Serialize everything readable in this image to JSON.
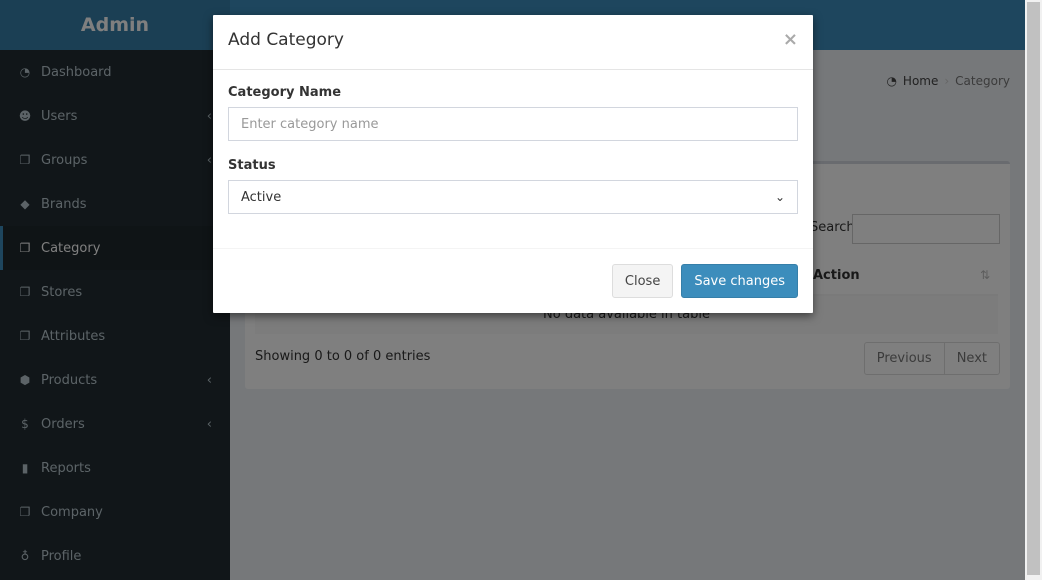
{
  "app": {
    "logo": "Admin"
  },
  "sidebar": {
    "items": [
      {
        "label": "Dashboard",
        "icon": "dashboard-icon",
        "glyph": "◔",
        "chevron": false,
        "active": false
      },
      {
        "label": "Users",
        "icon": "users-icon",
        "glyph": "☻",
        "chevron": true,
        "active": false
      },
      {
        "label": "Groups",
        "icon": "files-icon",
        "glyph": "❐",
        "chevron": true,
        "active": false
      },
      {
        "label": "Brands",
        "icon": "tags-icon",
        "glyph": "◆",
        "chevron": false,
        "active": false
      },
      {
        "label": "Category",
        "icon": "files-icon",
        "glyph": "❐",
        "chevron": false,
        "active": true
      },
      {
        "label": "Stores",
        "icon": "files-icon",
        "glyph": "❐",
        "chevron": false,
        "active": false
      },
      {
        "label": "Attributes",
        "icon": "files-icon",
        "glyph": "❐",
        "chevron": false,
        "active": false
      },
      {
        "label": "Products",
        "icon": "cube-icon",
        "glyph": "⬢",
        "chevron": true,
        "active": false
      },
      {
        "label": "Orders",
        "icon": "dollar-icon",
        "glyph": "$",
        "chevron": true,
        "active": false
      },
      {
        "label": "Reports",
        "icon": "bar-chart-icon",
        "glyph": "▮",
        "chevron": false,
        "active": false
      },
      {
        "label": "Company",
        "icon": "files-icon",
        "glyph": "❐",
        "chevron": false,
        "active": false
      },
      {
        "label": "Profile",
        "icon": "user-icon",
        "glyph": "♁",
        "chevron": false,
        "active": false
      }
    ],
    "chevron_glyph": "‹"
  },
  "breadcrumb": {
    "home": "Home",
    "current": "Category",
    "home_glyph": "◔"
  },
  "table": {
    "search_label": "Search:",
    "action_header": "Action",
    "sort_glyph": "⇅",
    "empty_text": "No data available in table",
    "info": "Showing 0 to 0 of 0 entries",
    "prev": "Previous",
    "next": "Next"
  },
  "modal": {
    "title": "Add Category",
    "close_glyph": "×",
    "name_label": "Category Name",
    "name_placeholder": "Enter category name",
    "status_label": "Status",
    "status_value": "Active",
    "select_chevron": "⌄",
    "close_button": "Close",
    "save_button": "Save changes"
  },
  "colors": {
    "header": "#3c8dbc",
    "logo_bg": "#367fa9",
    "sidebar": "#222d32",
    "primary": "#3c8dbc"
  }
}
